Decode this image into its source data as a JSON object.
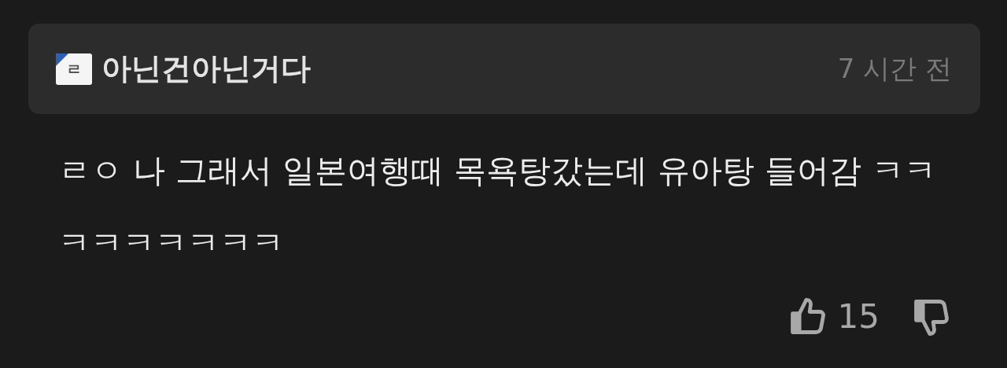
{
  "comment": {
    "author": {
      "level_badge": "ㄹ",
      "name": "아닌건아닌거다"
    },
    "time": "7 시간 전",
    "text": "ㄹㅇ 나 그래서 일본여행때 목욕탕갔는데 유아탕 들어감 ㅋㅋㅋㅋㅋㅋㅋㅋㅋ",
    "likes": "15"
  }
}
